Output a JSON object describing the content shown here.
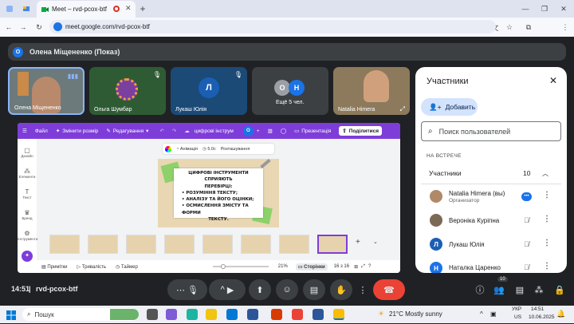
{
  "browser": {
    "tab_title": "Meet – rvd-pcox-btf",
    "url": "meet.google.com/rvd-pcox-btf"
  },
  "meet": {
    "presenter_initial": "О",
    "presenter_label": "Олена Міщененко (Показ)",
    "tiles": [
      {
        "name": "Олена Міщененко"
      },
      {
        "name": "Ольга Шумбар"
      },
      {
        "name": "Лукаш Юлія",
        "initial": "Л"
      },
      {
        "name": "Ещё 5 чел.",
        "initial_a": "О",
        "initial_b": "Н"
      },
      {
        "name": "Natalia Himera"
      }
    ],
    "time": "14:51",
    "meeting_code": "rvd-pcox-btf",
    "participants_badge": "10"
  },
  "canva": {
    "toolbar": {
      "file": "Файл",
      "resize": "Змінити розмір",
      "editing": "Редагування",
      "doc_title": "цифрові інструм",
      "avatar": "О",
      "present": "Презентація",
      "share": "Поділитися"
    },
    "left_panel": [
      "Дизайн",
      "Елементи",
      "Текст",
      "Бренд",
      "Інструменти",
      "Проєкти"
    ],
    "slide_toolbar": {
      "animation": "Анімація",
      "duration": "5.0с",
      "position": "Розташування"
    },
    "slide_lines": [
      "ЦИФРОВІ ІНСТРУМЕНТИ СПРИЯЮТЬ",
      "ПЕРЕВІРЦІ:",
      "•  РОЗУМІННЯ ТЕКСТУ;",
      "•  АНАЛІЗУ ТА ЙОГО ОЦІНКИ;",
      "•  ОСМИСЛЕННЯ ЗМІСТУ ТА ФОРМИ",
      "ТЕКСТУ."
    ],
    "bottom": {
      "notes": "Примітки",
      "duration": "Тривалість",
      "timer": "Таймер",
      "zoom": "21%",
      "pages": "Сторінки",
      "page_count": "16 з 16"
    }
  },
  "participants": {
    "title": "Участники",
    "add_label": "Добавить",
    "search_placeholder": "Поиск пользователей",
    "section_label": "НА ВСТРЕЧЕ",
    "group_label": "Участники",
    "group_count": "10",
    "people": [
      {
        "name": "Natalia Himera (вы)",
        "role": "Организатор"
      },
      {
        "name": "Вероніка Куріпна",
        "role": ""
      },
      {
        "name": "Лукаш Юлія",
        "role": "",
        "initial": "Л"
      },
      {
        "name": "Наталка Царенко",
        "role": "",
        "initial": "Н"
      }
    ]
  },
  "taskbar": {
    "search": "Пошук",
    "weather": "21°C  Mostly sunny",
    "lang_a": "УКР",
    "lang_b": "US",
    "clock_time": "14:51",
    "clock_date": "10.06.2025"
  },
  "colors": {
    "meet_bg": "#202124",
    "canva_purple": "#7e3dd9",
    "accent_blue": "#1a73e8",
    "end_call_red": "#ea4335"
  }
}
